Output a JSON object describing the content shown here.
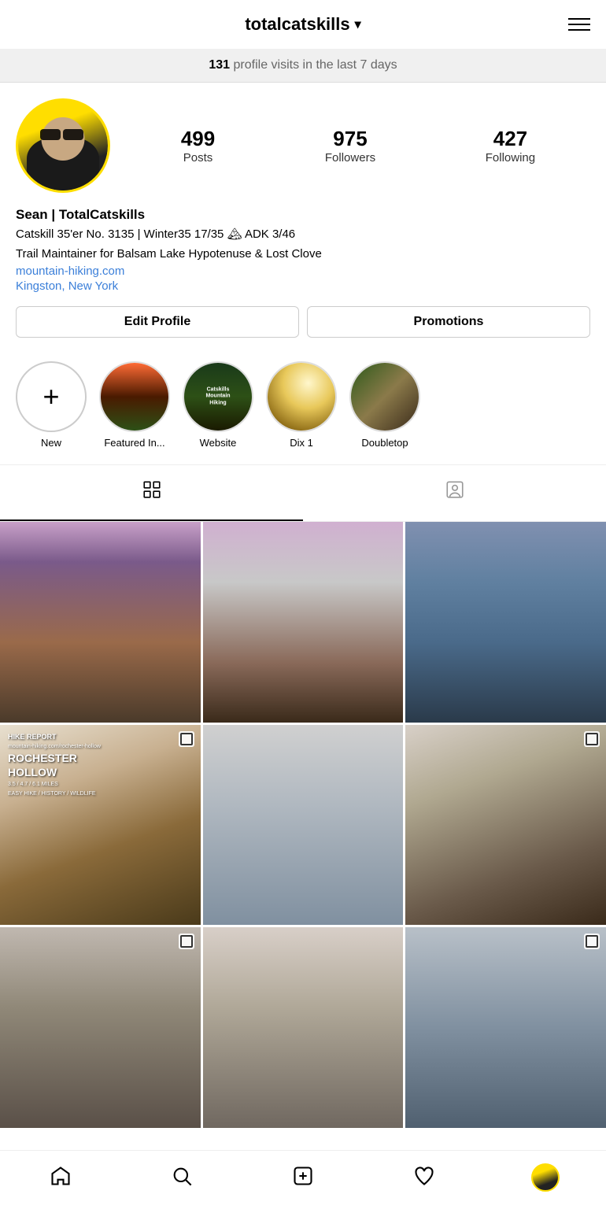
{
  "topbar": {
    "username": "totalcatskills",
    "chevron": "▾",
    "hamburger_label": "menu"
  },
  "stats_banner": {
    "count": "131",
    "text": " profile visits in the last 7 days"
  },
  "profile": {
    "posts_count": "499",
    "posts_label": "Posts",
    "followers_count": "975",
    "followers_label": "Followers",
    "following_count": "427",
    "following_label": "Following",
    "name": "Sean | TotalCatskills",
    "bio_line1": "Catskill 35'er No. 3135 | Winter35 17/35 🏔 ADK 3/46",
    "bio_line2": "Trail Maintainer for Balsam Lake Hypotenuse & Lost Clove",
    "website": "mountain-hiking.com",
    "location": "Kingston, New York",
    "edit_profile_btn": "Edit Profile",
    "promotions_btn": "Promotions"
  },
  "stories": [
    {
      "label": "New",
      "type": "new"
    },
    {
      "label": "Featured In...",
      "type": "img1"
    },
    {
      "label": "Website",
      "type": "img2"
    },
    {
      "label": "Dix 1",
      "type": "img3"
    },
    {
      "label": "Doubletop",
      "type": "img4"
    }
  ],
  "tabs": [
    {
      "label": "grid-tab",
      "icon": "grid",
      "active": true
    },
    {
      "label": "tagged-tab",
      "icon": "person-frame",
      "active": false
    }
  ],
  "grid": [
    {
      "id": "photo-1",
      "type": "landscape-lake",
      "has_multi": false
    },
    {
      "id": "photo-2",
      "type": "bridge-snow",
      "has_multi": false
    },
    {
      "id": "photo-3",
      "type": "mountain-lake",
      "has_multi": false
    },
    {
      "id": "photo-4",
      "type": "hike-report",
      "has_multi": true,
      "overlay": "HIKE REPORT\nmountain-hiking.com/rochester-hollow\nROCHESTER\nHOLLOW\n3.5 / 4.7 / 6.1 MILES\nEASY HIKE / HISTORY / WILDLIFE"
    },
    {
      "id": "photo-5",
      "type": "snow-paw",
      "has_multi": false
    },
    {
      "id": "photo-6",
      "type": "snowy-woods",
      "has_multi": true
    },
    {
      "id": "photo-7",
      "type": "winter-trail-1",
      "has_multi": true
    },
    {
      "id": "photo-8",
      "type": "winter-trail-2",
      "has_multi": false
    },
    {
      "id": "photo-9",
      "type": "winter-trail-3",
      "has_multi": true
    }
  ],
  "bottom_nav": {
    "home_label": "home",
    "search_label": "search",
    "add_label": "add",
    "heart_label": "activity",
    "profile_label": "profile"
  }
}
